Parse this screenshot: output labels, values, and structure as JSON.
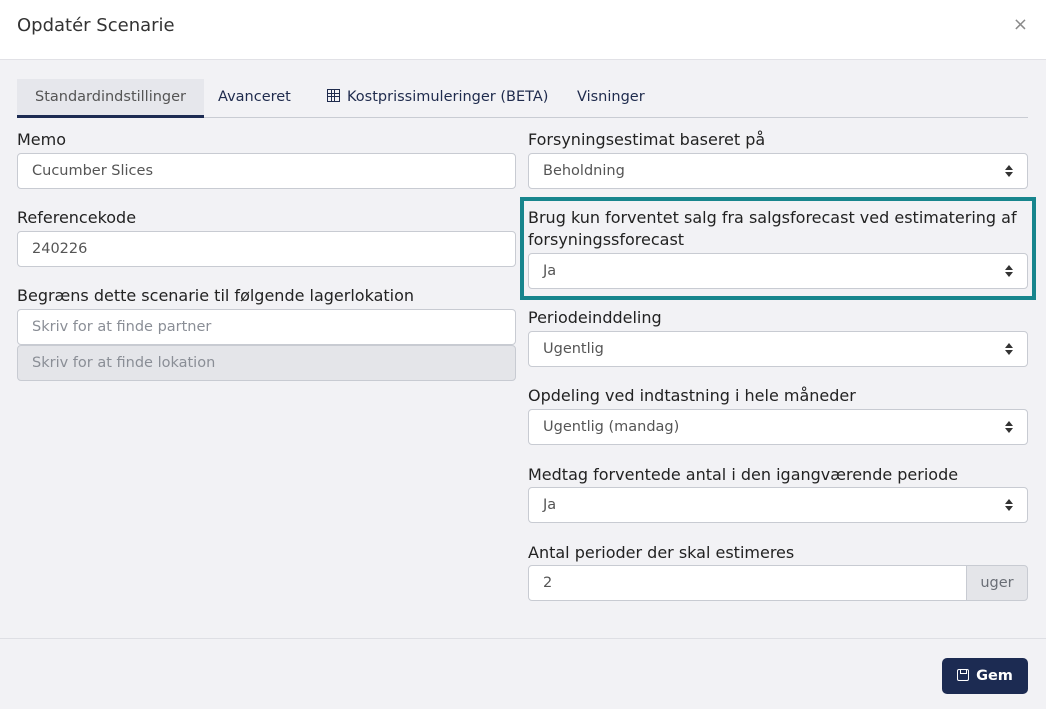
{
  "dialog": {
    "title": "Opdatér Scenarie",
    "close_label": "×"
  },
  "tabs": [
    {
      "label": "Standardindstillinger",
      "active": true
    },
    {
      "label": "Avanceret",
      "active": false
    },
    {
      "label": "Kostprissimuleringer (BETA)",
      "active": false,
      "icon": "table-icon"
    },
    {
      "label": "Visninger",
      "active": false
    }
  ],
  "left": {
    "memo": {
      "label": "Memo",
      "value": "Cucumber Slices"
    },
    "reference": {
      "label": "Referencekode",
      "value": "240226"
    },
    "restrict": {
      "label": "Begræns dette scenarie til følgende lagerlokation",
      "partner_placeholder": "Skriv for at finde partner",
      "location_placeholder": "Skriv for at finde lokation"
    }
  },
  "right": {
    "supply_estimate": {
      "label": "Forsyningsestimat baseret på",
      "value": "Beholdning"
    },
    "use_sales_forecast": {
      "label": "Brug kun forventet salg fra salgsforecast ved estimatering af forsyningssforecast",
      "value": "Ja"
    },
    "period_split": {
      "label": "Periodeinddeling",
      "value": "Ugentlig"
    },
    "month_split": {
      "label": "Opdeling ved indtastning i hele måneder",
      "value": "Ugentlig (mandag)"
    },
    "include_expected": {
      "label": "Medtag forventede antal i den igangværende periode",
      "value": "Ja"
    },
    "periods_count": {
      "label": "Antal perioder der skal estimeres",
      "value": "2",
      "unit": "uger"
    }
  },
  "footer": {
    "save_label": "Gem",
    "save_icon": "floppy-disk-icon"
  },
  "colors": {
    "primary": "#1c2b52",
    "highlight": "#17858d"
  }
}
